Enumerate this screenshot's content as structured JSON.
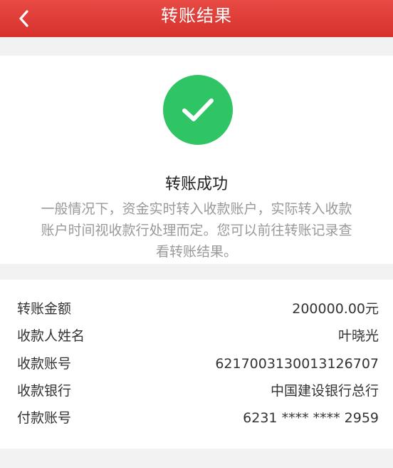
{
  "header": {
    "title": "转账结果",
    "back_icon": "chevron-left-icon"
  },
  "result": {
    "icon": "check-icon",
    "title": "转账成功",
    "description": "一般情况下，资金实时转入收款账户，实际转入收款账户时间视收款行处理而定。您可以前往转账记录查看转账结果。"
  },
  "details": [
    {
      "label": "转账金额",
      "value": "200000.00元"
    },
    {
      "label": "收款人姓名",
      "value": "叶晓光"
    },
    {
      "label": "收款账号",
      "value": "6217003130013126707"
    },
    {
      "label": "收款银行",
      "value": "中国建设银行总行"
    },
    {
      "label": "付款账号",
      "value": "6231 **** **** 2959"
    }
  ],
  "colors": {
    "header": "#d7312d",
    "success": "#2fc464",
    "background": "#f2f2f2"
  }
}
